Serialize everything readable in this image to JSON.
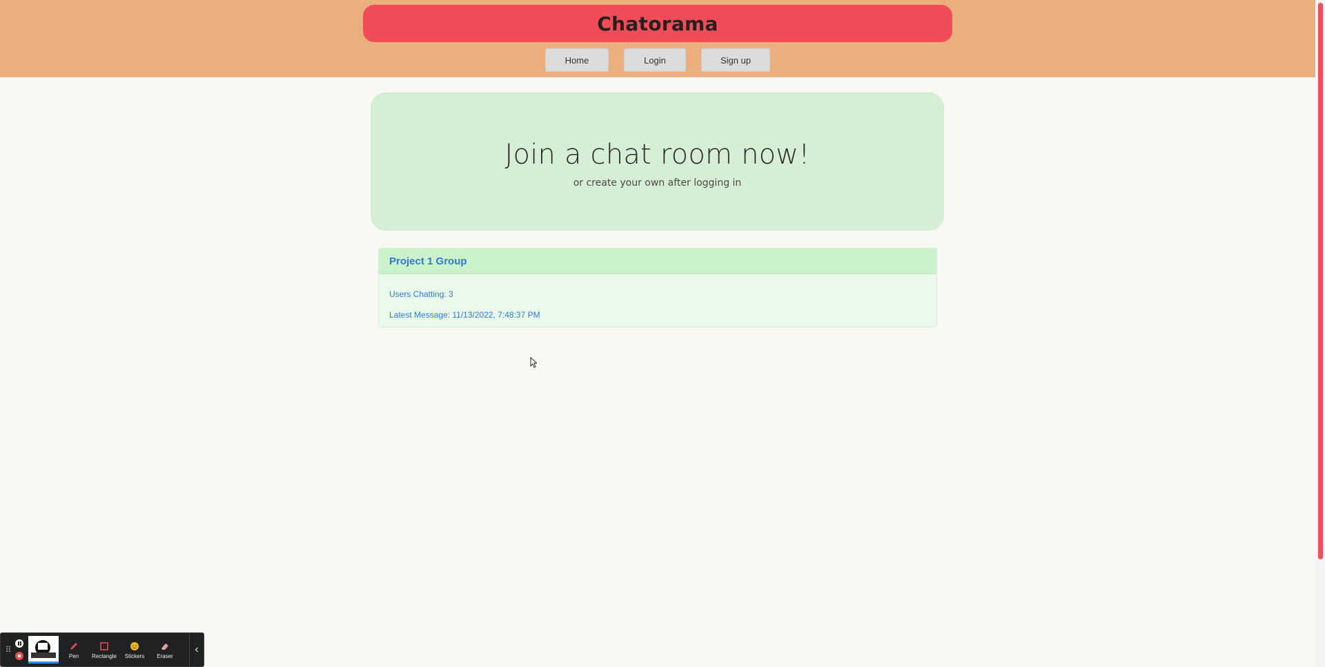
{
  "header": {
    "brand": "Chatorama",
    "nav": {
      "home": "Home",
      "login": "Login",
      "signup": "Sign up"
    }
  },
  "hero": {
    "title": "Join a chat room now!",
    "subtitle": "or create your own after logging in"
  },
  "rooms": [
    {
      "name": "Project 1 Group",
      "users_label": "Users Chatting: 3",
      "latest_label": "Latest Message: 11/13/2022, 7:48:37 PM"
    }
  ],
  "toolbar": {
    "tools": {
      "pen": "Pen",
      "rectangle": "Rectangle",
      "stickers": "Stickers",
      "eraser": "Eraser"
    }
  },
  "colors": {
    "header_bg": "#ebaf7e",
    "brand_bg": "#f04d58",
    "hero_bg": "#d6efd4",
    "card_header_bg": "#caf3cd",
    "link": "#2e7bd0"
  }
}
